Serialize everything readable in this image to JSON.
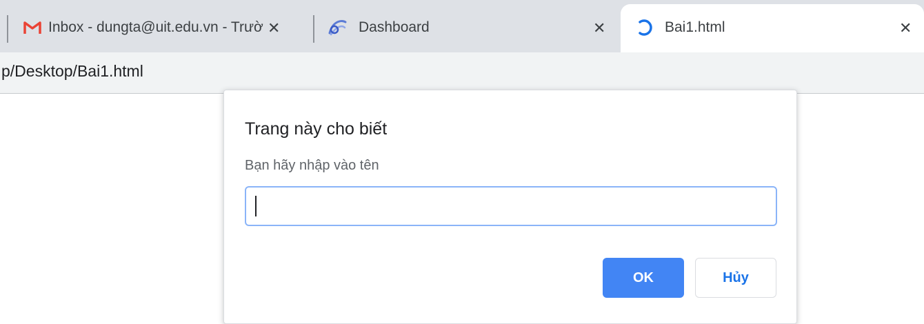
{
  "tabs": [
    {
      "title": "Inbox - dungta@uit.edu.vn - Trườ",
      "icon": "gmail-icon",
      "active": false
    },
    {
      "title": "Dashboard",
      "icon": "dashboard-logo-icon",
      "active": false
    },
    {
      "title": "Bai1.html",
      "icon": "loading-spinner-icon",
      "active": true
    }
  ],
  "address_bar": {
    "url": "p/Desktop/Bai1.html"
  },
  "dialog": {
    "title": "Trang này cho biết",
    "message": "Bạn hãy nhập vào tên",
    "input_value": "",
    "ok_label": "OK",
    "cancel_label": "Hủy"
  },
  "colors": {
    "tabstrip_bg": "#dee1e6",
    "accent": "#4285f4",
    "cancel_text": "#1a73e8",
    "gmail_red": "#ea4335",
    "spinner_blue": "#1a73e8",
    "input_focus": "#8ab4f8"
  }
}
